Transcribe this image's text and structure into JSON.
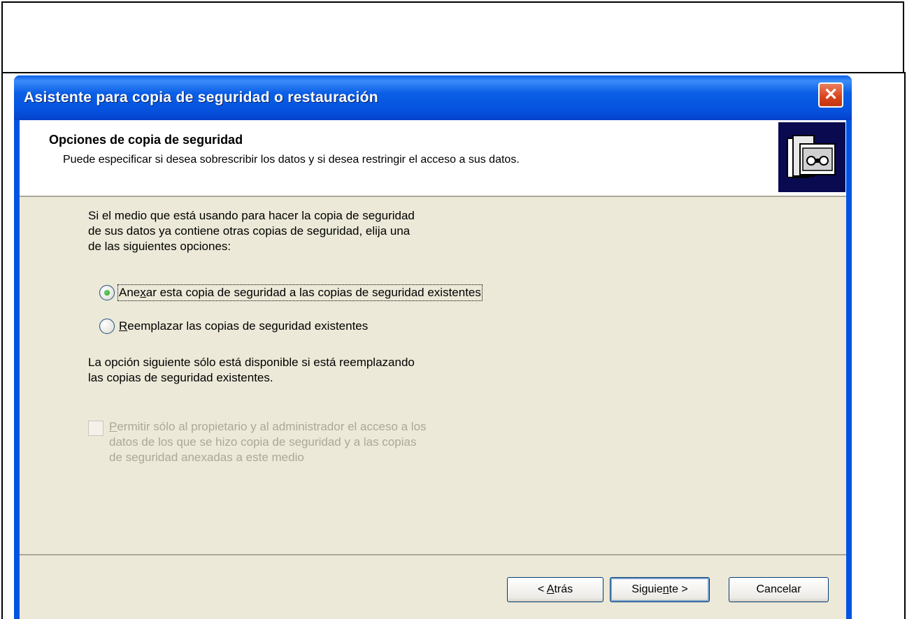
{
  "window": {
    "title": "Asistente para copia de seguridad o restauración",
    "close_glyph": "✕"
  },
  "header": {
    "title": "Opciones de copia de seguridad",
    "subtitle": "Puede especificar si desea sobrescribir los datos y si desea restringir el acceso a sus datos.",
    "icon": "backup-tape-icon"
  },
  "intro": {
    "line1": "Si el medio que está usando para hacer la copia de seguridad",
    "line2": "de sus datos ya contiene otras copias de seguridad, elija una",
    "line3": "de las siguientes opciones:"
  },
  "options": {
    "append": {
      "pre": "Ane",
      "key": "x",
      "post": "ar esta copia de seguridad a las copias de seguridad existentes",
      "checked": true
    },
    "replace": {
      "pre": "",
      "key": "R",
      "post": "eemplazar las copias de seguridad existentes",
      "checked": false
    }
  },
  "note": {
    "line1": "La opción siguiente sólo está disponible si está reemplazando",
    "line2": "las copias de seguridad existentes."
  },
  "restrict": {
    "line1_key": "P",
    "line1_rest": "ermitir sólo al propietario y al administrador el acceso a los",
    "line2": "datos de los que se hizo copia de seguridad y a las copias",
    "line3": "de seguridad anexadas a este medio",
    "enabled": false
  },
  "buttons": {
    "back": {
      "pre": "< ",
      "key": "A",
      "post": "trás"
    },
    "next": {
      "pre": "Siguie",
      "key": "n",
      "post": "te >"
    },
    "cancel": {
      "label": "Cancelar"
    }
  },
  "colors": {
    "titlebar": "#0054e3",
    "dialog_bg": "#ece9d8",
    "disabled_text": "#aca899",
    "radio_dot": "#21a121"
  }
}
